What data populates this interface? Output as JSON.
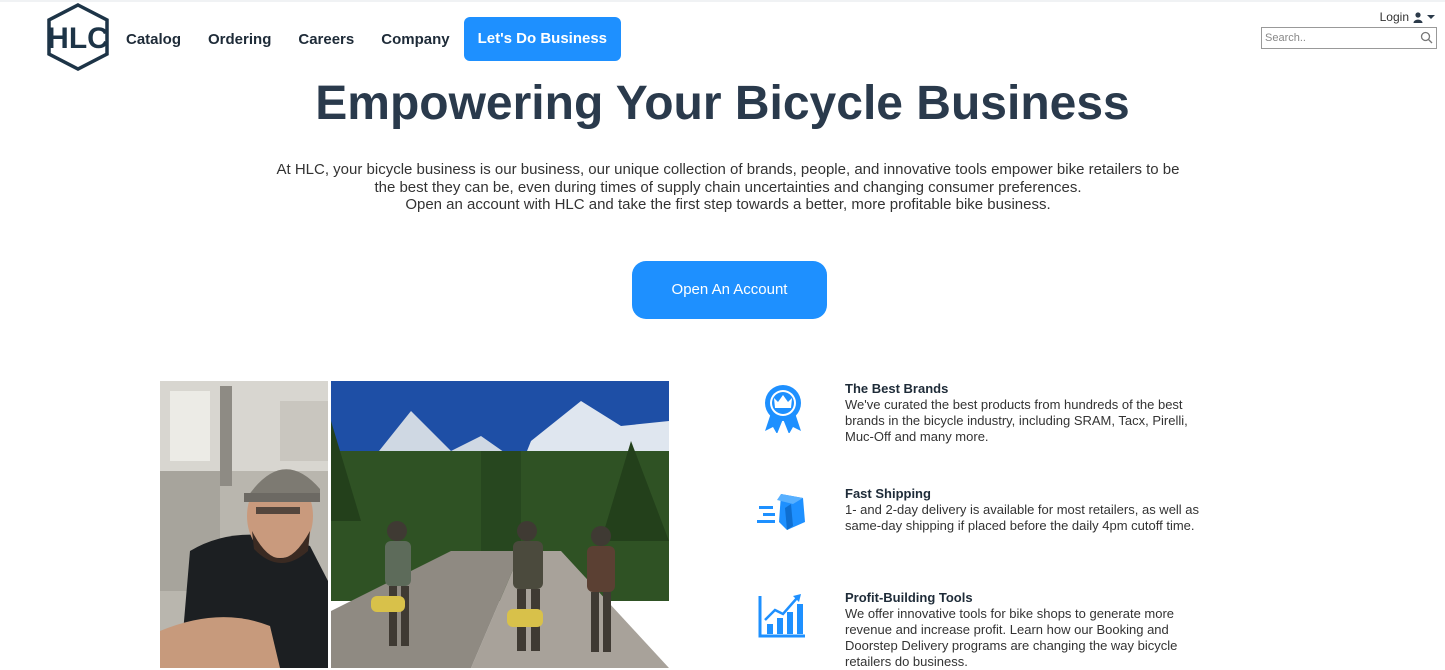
{
  "brand": {
    "logo_text": "HLC"
  },
  "nav": {
    "items": [
      {
        "label": "Catalog"
      },
      {
        "label": "Ordering"
      },
      {
        "label": "Careers"
      },
      {
        "label": "Company"
      }
    ],
    "cta_label": "Let's Do Business"
  },
  "header": {
    "login_label": "Login",
    "search_placeholder": "Search.."
  },
  "hero": {
    "title": "Empowering Your Bicycle Business",
    "lines": [
      "At HLC, your bicycle business is our business, our unique collection of brands, people, and innovative tools empower bike retailers to be",
      "the best they can be, even during times of supply chain uncertainties and changing consumer preferences.",
      "Open an account with HLC and take the first step towards a better, more profitable bike business."
    ],
    "button_label": "Open An Account"
  },
  "features": [
    {
      "title": "The Best Brands",
      "icon": "ribbon-crown-icon",
      "description": "We've curated the best products from hundreds of the best brands in the bicycle industry, including SRAM, Tacx, Pirelli, Muc-Off and many more."
    },
    {
      "title": "Fast Shipping",
      "icon": "fast-box-icon",
      "description": "1- and 2-day delivery is available for most retailers, as well as same-day shipping if placed before the daily 4pm cutoff time."
    },
    {
      "title": "Profit-Building Tools",
      "icon": "growth-chart-icon",
      "description": "We offer innovative tools for bike shops to generate more revenue and increase profit. Learn how our Booking and Doorstep Delivery programs are changing the way bicycle retailers do business."
    }
  ],
  "colors": {
    "accent": "#1e90ff",
    "heading": "#2a3a4c",
    "logo": "#1d3447"
  }
}
